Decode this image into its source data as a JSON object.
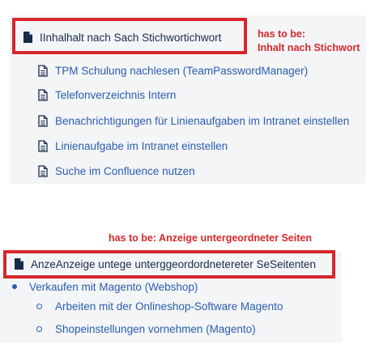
{
  "section1": {
    "title": "IInhalhalt  nach Sach Stichwortichwort",
    "note_line1": "has to be:",
    "note_line2": "Inhalt nach  Stichwort",
    "links": [
      "TPM Schulung nachlesen (TeamPasswordManager)",
      "Telefonverzeichnis Intern",
      "Benachrichtigungen für Linienaufgaben im Intranet einstellen",
      "Linienaufgabe im Intranet einstellen",
      "Suche im Confluence nutzen"
    ]
  },
  "section2": {
    "note": "has to be: Anzeige untergeordneter Seiten",
    "title": "AnzeAnzeige untege unterggeordordnetereter SeSeitenten",
    "parent_link": "Verkaufen mit Magento (Webshop)",
    "children": [
      "Arbeiten mit der Onlineshop-Software Magento",
      "Shopeinstellungen vornehmen (Magento)"
    ]
  },
  "colors": {
    "annotation_red": "#d7272c",
    "link_blue": "#2a5db0",
    "panel_bg": "#f4f5f7",
    "title_text": "#172b4d"
  },
  "icons": {
    "title_icon": "filled-document-icon",
    "link_icon": "page-outline-icon",
    "list_bullet": "disc-bullet",
    "child_bullet": "circle-bullet"
  }
}
